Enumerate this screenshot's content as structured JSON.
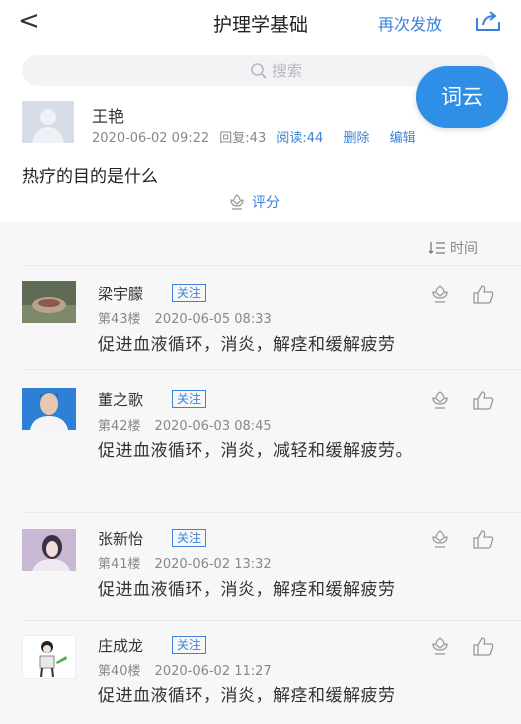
{
  "header": {
    "back_glyph": "<",
    "title": "护理学基础",
    "resend": "再次发放"
  },
  "search": {
    "placeholder": "搜索"
  },
  "fab": {
    "label": "词云"
  },
  "post": {
    "author": "王艳",
    "datetime": "2020-06-02 09:22",
    "replies": "回复:43",
    "reads": "阅读:44",
    "delete": "删除",
    "edit": "编辑",
    "question": "热疗的目的是什么",
    "rate": "评分"
  },
  "sort": {
    "label": "时间"
  },
  "follow_label": "关注",
  "comments": [
    {
      "name": "梁宇朦",
      "floor": "第43楼",
      "time": "2020-06-05 08:33",
      "text": "促进血液循环，消炎，解痉和缓解疲劳"
    },
    {
      "name": "董之歌",
      "floor": "第42楼",
      "time": "2020-06-03 08:45",
      "text": "促进血液循环，消炎，减轻和缓解疲劳。"
    },
    {
      "name": "张新怡",
      "floor": "第41楼",
      "time": "2020-06-02 13:32",
      "text": "促进血液循环，消炎，解痉和缓解疲劳"
    },
    {
      "name": "庄成龙",
      "floor": "第40楼",
      "time": "2020-06-02 11:27",
      "text": "促进血液循环，消炎，解痉和缓解疲劳"
    }
  ],
  "colors": {
    "accent": "#3b82d8",
    "fab": "#2f8ee6",
    "muted": "#888888"
  }
}
